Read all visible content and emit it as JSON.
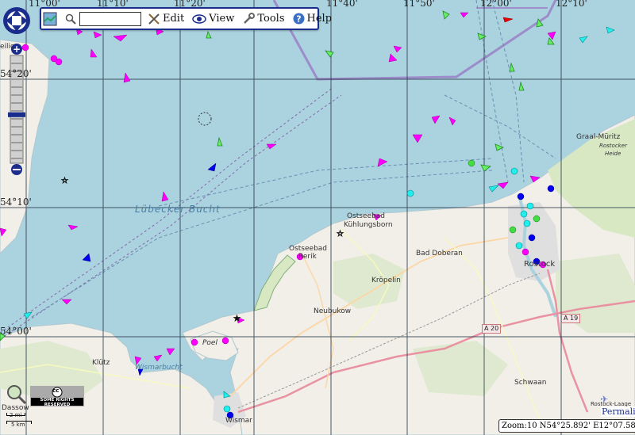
{
  "colors": {
    "sea": "#aad3df",
    "land": "#f2efe9",
    "field": "#d7e8c3",
    "urban": "#e0dfdf",
    "grid": "#223344",
    "ferry": "#9b7fc7",
    "ship_magenta": "#ff00ff",
    "ship_green": "#33cc33",
    "ship_cyan": "#00e5e5",
    "ship_blue": "#0000ee",
    "toolbar_border": "#1a2d8c"
  },
  "toolbar": {
    "map_icon": "map-icon",
    "search_icon": "magnifier-icon",
    "search_value": "",
    "edit_label": "Edit",
    "view_label": "View",
    "tools_label": "Tools",
    "help_label": "Help"
  },
  "zoom": {
    "plus": "+",
    "minus": "−",
    "level_fraction": 0.55
  },
  "coordinates": {
    "top": [
      "11°00'",
      "11°10'",
      "11°20'",
      "11°40'",
      "11°50'",
      "12°00'",
      "12°10'"
    ],
    "left": [
      "54°20'",
      "54°10'",
      "54°00'"
    ]
  },
  "places": {
    "sea": "Lübecker Bucht",
    "ostseebad_kuhlungsborn_1": "Ostseebad",
    "ostseebad_kuhlungsborn_2": "Kühlungsborn",
    "rerik_1": "Ostseebad",
    "rerik_2": "Rerik",
    "bad_doberan": "Bad Doberan",
    "kropelin": "Kröpelin",
    "neubukow": "Neubukow",
    "rostock": "Rostock",
    "poel": "Poel",
    "wismar": "Wismar",
    "wismarbucht": "Wismarbucht",
    "klutz": "Klütz",
    "dassow": "Dassow",
    "schwaan": "Schwaan",
    "graal_muritz": "Graal-Müritz",
    "rostocker_heide_1": "Rostocker",
    "rostocker_heide_2": "Heide",
    "airport": "Rostock-Laage",
    "heiligenhafen": "eilig"
  },
  "roads": {
    "a20": "A 20",
    "a19": "A 19"
  },
  "cc": {
    "symbol": "cc",
    "text": "SOME RIGHTS RESERVED"
  },
  "scale": {
    "mi": "2 mi",
    "km": "5 km"
  },
  "status": "Zoom:10 N54°25.892' E12°07.585'",
  "permalink": "Permalink"
}
